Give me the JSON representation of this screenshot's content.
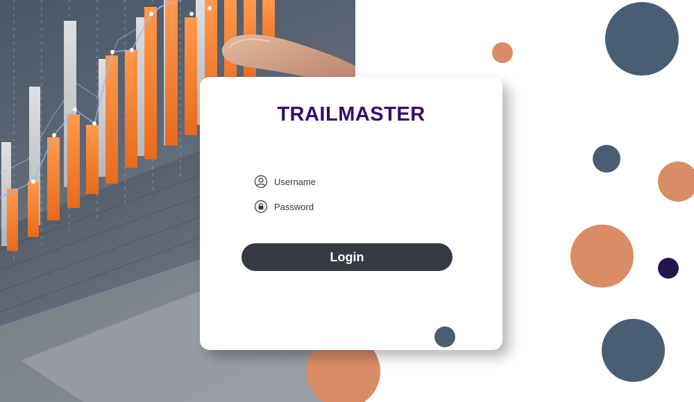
{
  "brand": {
    "name": "TRAILMASTER",
    "color": "#3a0b6b"
  },
  "form": {
    "username_label": "Username",
    "username_icon": "user-circle-icon",
    "password_label": "Password",
    "password_icon": "lock-circle-icon",
    "login_label": "Login"
  },
  "colors": {
    "login_button": "#353a45",
    "circle_slate": "#4a5e73",
    "circle_orange": "#d98c65",
    "circle_navy": "#231650"
  }
}
